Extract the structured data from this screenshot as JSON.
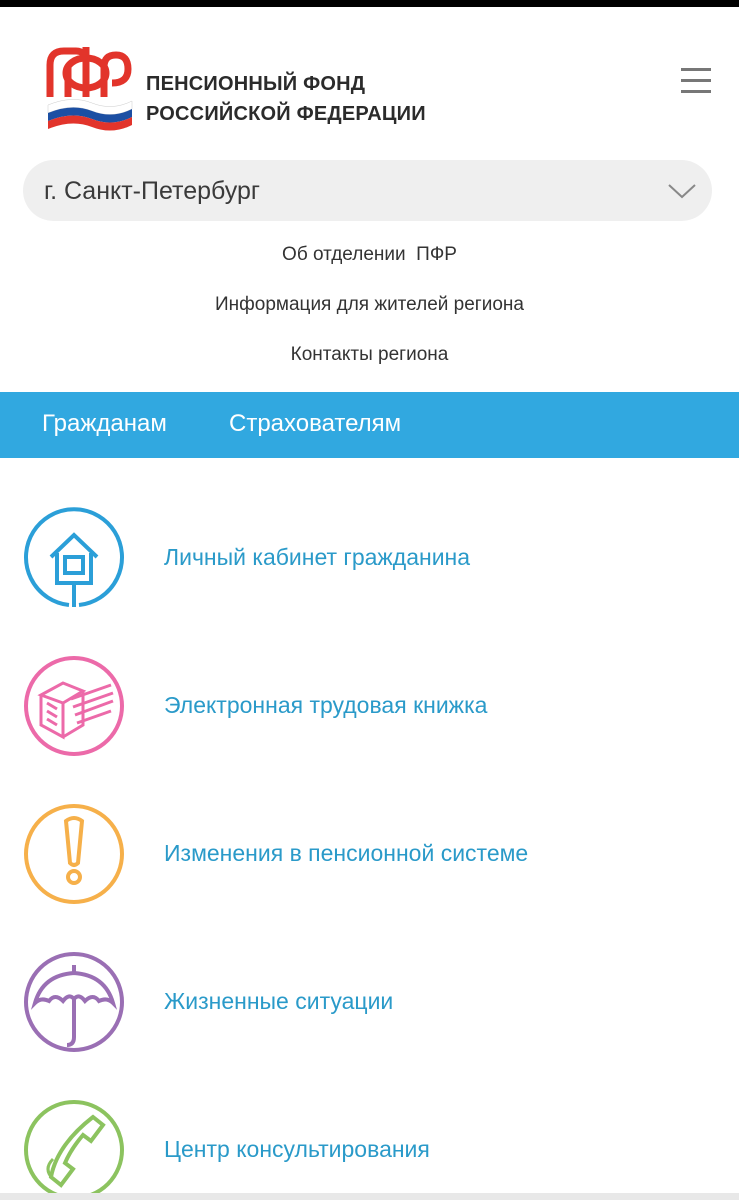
{
  "header": {
    "org_line1": "ПЕНСИОННЫЙ ФОНД",
    "org_line2": "РОССИЙСКОЙ ФЕДЕРАЦИИ",
    "logo_icon": "pfr-logo-icon",
    "menu_icon": "hamburger-menu-icon"
  },
  "region": {
    "selected": "г. Санкт-Петербург",
    "icon": "chevron-down-icon"
  },
  "sub_links": [
    "Об отделении  ПФР",
    "Информация для жителей региона",
    "Контакты региона"
  ],
  "tabs": [
    {
      "label": "Гражданам"
    },
    {
      "label": "Страхователям"
    }
  ],
  "services": [
    {
      "label": "Личный кабинет гражданина",
      "icon": "house-icon",
      "color": "#2b9fd8"
    },
    {
      "label": "Электронная трудовая книжка",
      "icon": "book-icon",
      "color": "#ec6aa9"
    },
    {
      "label": "Изменения в пенсионной системе",
      "icon": "exclamation-icon",
      "color": "#f6b04a"
    },
    {
      "label": "Жизненные ситуации",
      "icon": "umbrella-icon",
      "color": "#9a6fb4"
    },
    {
      "label": "Центр консультирования",
      "icon": "phone-icon",
      "color": "#8cc35f"
    }
  ],
  "colors": {
    "accent": "#31a8e0",
    "link": "#2a9ac9"
  }
}
